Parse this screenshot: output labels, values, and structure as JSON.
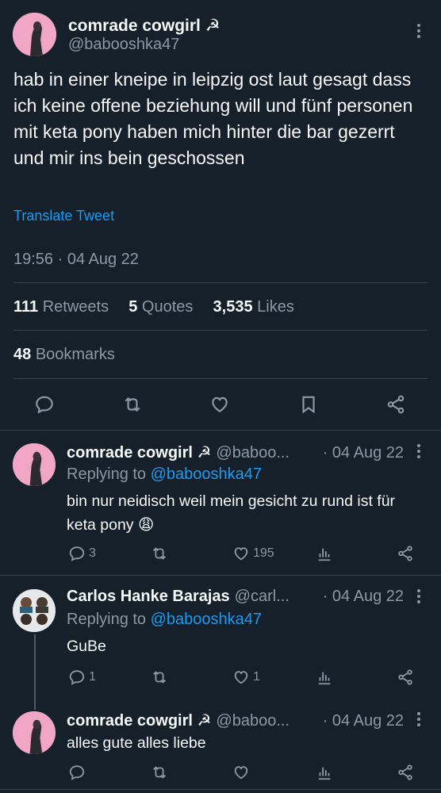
{
  "tweet": {
    "author_name": "comrade cowgirl ☭",
    "author_handle": "@babooshka47",
    "text": "hab in einer kneipe in leipzig ost laut gesagt dass ich keine offene beziehung will und fünf personen mit keta pony haben mich hinter die bar gezerrt und mir ins bein geschossen",
    "translate_label": "Translate Tweet",
    "timestamp": "19:56 · 04 Aug 22",
    "stats": {
      "retweets_count": "111",
      "retweets_label": "Retweets",
      "quotes_count": "5",
      "quotes_label": "Quotes",
      "likes_count": "3,535",
      "likes_label": "Likes",
      "bookmarks_count": "48",
      "bookmarks_label": "Bookmarks"
    },
    "actions": [
      "reply-icon",
      "retweet-icon",
      "like-icon",
      "bookmark-icon",
      "share-icon"
    ]
  },
  "replies": [
    {
      "author_name": "comrade cowgirl ☭",
      "author_handle": "@baboo...",
      "date": "· 04 Aug 22",
      "replying_prefix": "Replying to",
      "replying_handle": "@babooshka47",
      "text": "bin nur neidisch weil mein gesicht zu rund ist für keta pony 😩",
      "reply_count": "3",
      "like_count": "195"
    },
    {
      "author_name": "Carlos Hanke Barajas",
      "author_handle": "@carl...",
      "date": "· 04 Aug 22",
      "replying_prefix": "Replying to",
      "replying_handle": "@babooshka47",
      "text": "GuBe",
      "reply_count": "1",
      "like_count": "1"
    },
    {
      "author_name": "comrade cowgirl ☭",
      "author_handle": "@baboo...",
      "date": "· 04 Aug 22",
      "text": "alles gute alles liebe"
    }
  ],
  "colors": {
    "background": "#15202b",
    "text": "#f7f9f9",
    "muted": "#8b98a5",
    "link": "#1d9bf0",
    "divider": "#38444d",
    "avatar_pink": "#f0a6c4"
  }
}
